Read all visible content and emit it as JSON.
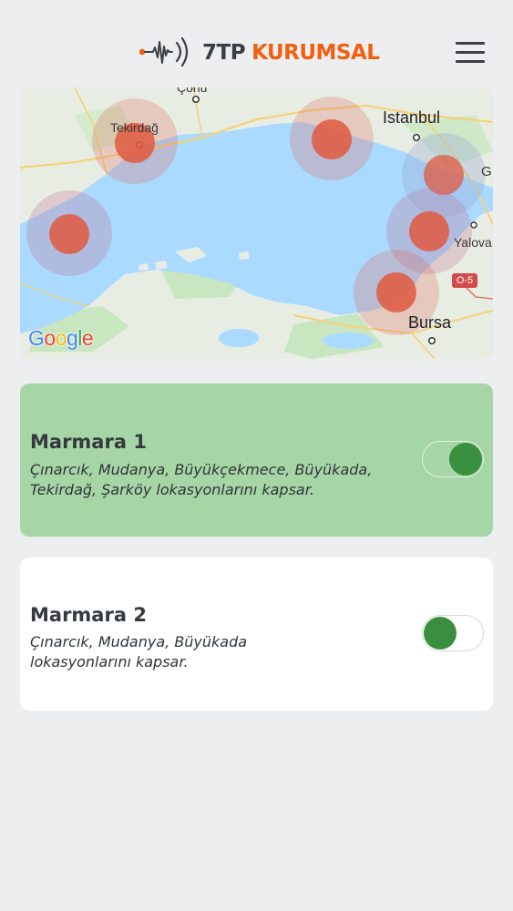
{
  "header": {
    "logo_num": "7TP",
    "logo_word": "KURUMSAL",
    "brand_color": "#f0600f",
    "menu_icon": "hamburger-menu-icon"
  },
  "map": {
    "labels": {
      "tekirdag": "Tekirdağ",
      "corlu": "Çorlu",
      "istanbul": "Istanbul",
      "yalova": "Yalova",
      "g": "G",
      "bursa": "Bursa",
      "road": "O-5"
    },
    "attribution": "Google"
  },
  "regions": [
    {
      "title": "Marmara 1",
      "description": "Çınarcık, Mudanya, Büyükçekmece, Büyükada, Tekirdağ, Şarköy lokasyonlarını kapsar.",
      "enabled": true,
      "bg_color": "#a6d6a6"
    },
    {
      "title": "Marmara 2",
      "description": "Çınarcık, Mudanya, Büyükada lokasyonlarını kapsar.",
      "enabled": false,
      "bg_color": "#ffffff"
    }
  ],
  "colors": {
    "toggle_knob": "#3a8f3f",
    "marker": "#e0593f",
    "sea": "#aadaff"
  }
}
